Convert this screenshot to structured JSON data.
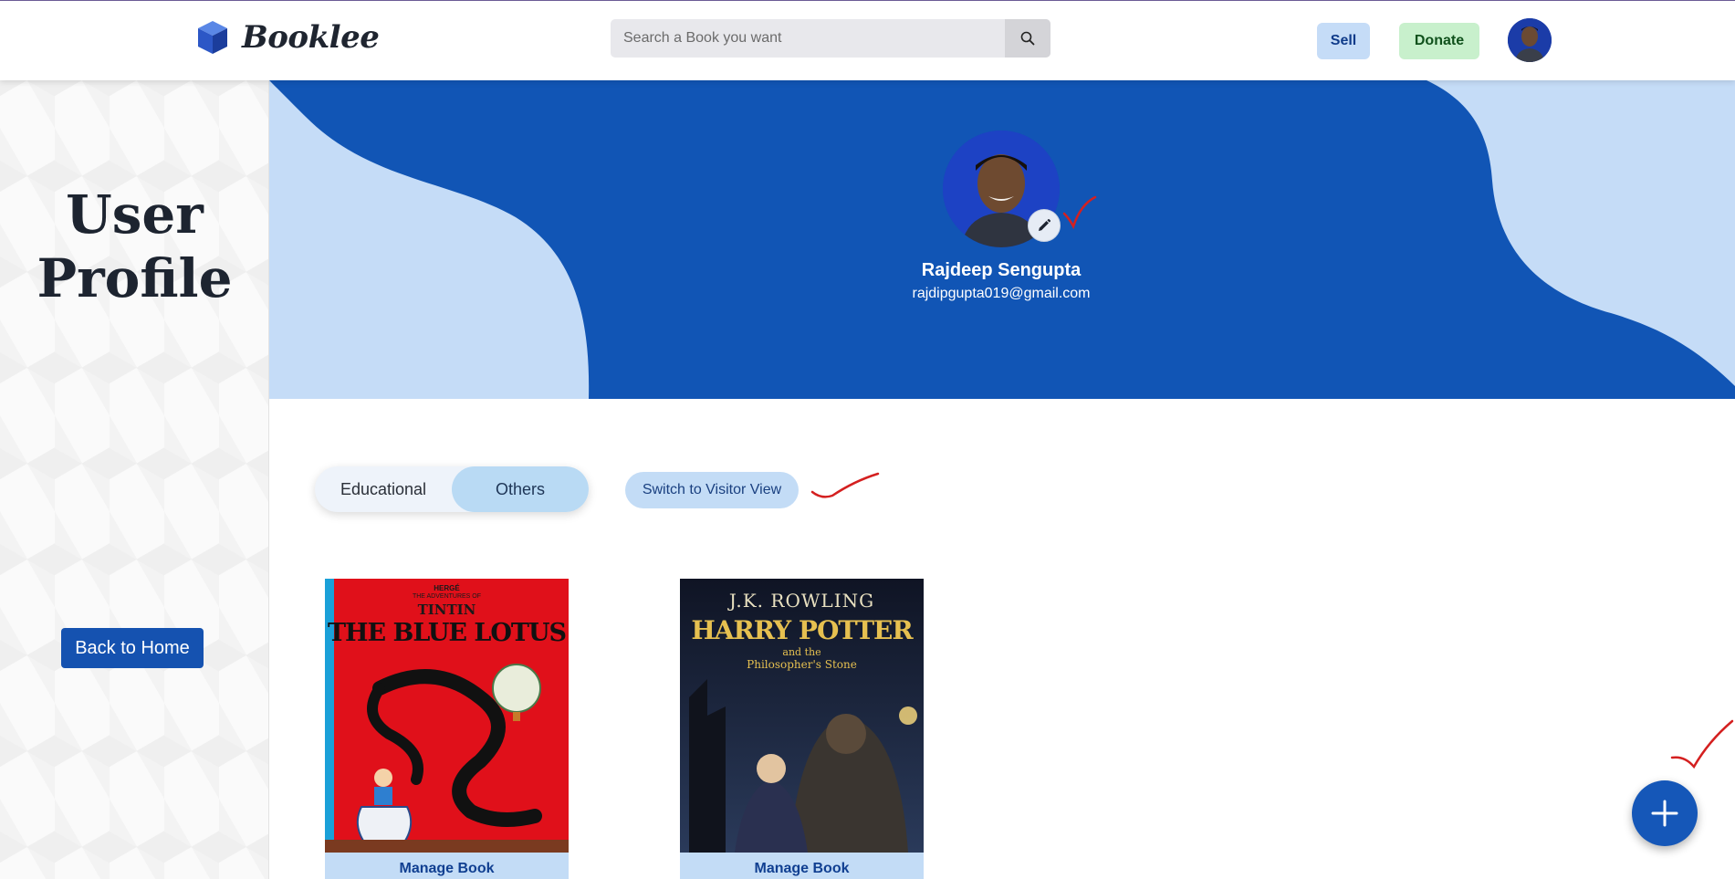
{
  "header": {
    "brand": "Booklee",
    "search": {
      "placeholder": "Search a Book you want",
      "value": ""
    },
    "sell_label": "Sell",
    "donate_label": "Donate"
  },
  "sidebar": {
    "title_line1": "User",
    "title_line2": "Profile",
    "back_home_label": "Back to Home"
  },
  "profile": {
    "name": "Rajdeep Sengupta",
    "email": "rajdipgupta019@gmail.com"
  },
  "categories": {
    "tabs": [
      "Educational",
      "Others"
    ],
    "active": "Others"
  },
  "visitor_view_label": "Switch to Visitor View",
  "books": [
    {
      "cover_lines": [
        "HERGÉ",
        "THE ADVENTURES OF",
        "TINTIN",
        "THE BLUE LOTUS"
      ],
      "manage_label": "Manage Book"
    },
    {
      "cover_lines": [
        "J.K. ROWLING",
        "HARRY POTTER",
        "and the",
        "Philosopher's Stone"
      ],
      "manage_label": "Manage Book"
    }
  ],
  "colors": {
    "banner": "#1155b5",
    "banner_light": "#c5dcf7",
    "primary_button": "#1552b0",
    "annotation_marks": "#d42020"
  },
  "icons": {
    "search": "search-icon",
    "edit": "pencil-icon",
    "add": "plus-icon"
  }
}
